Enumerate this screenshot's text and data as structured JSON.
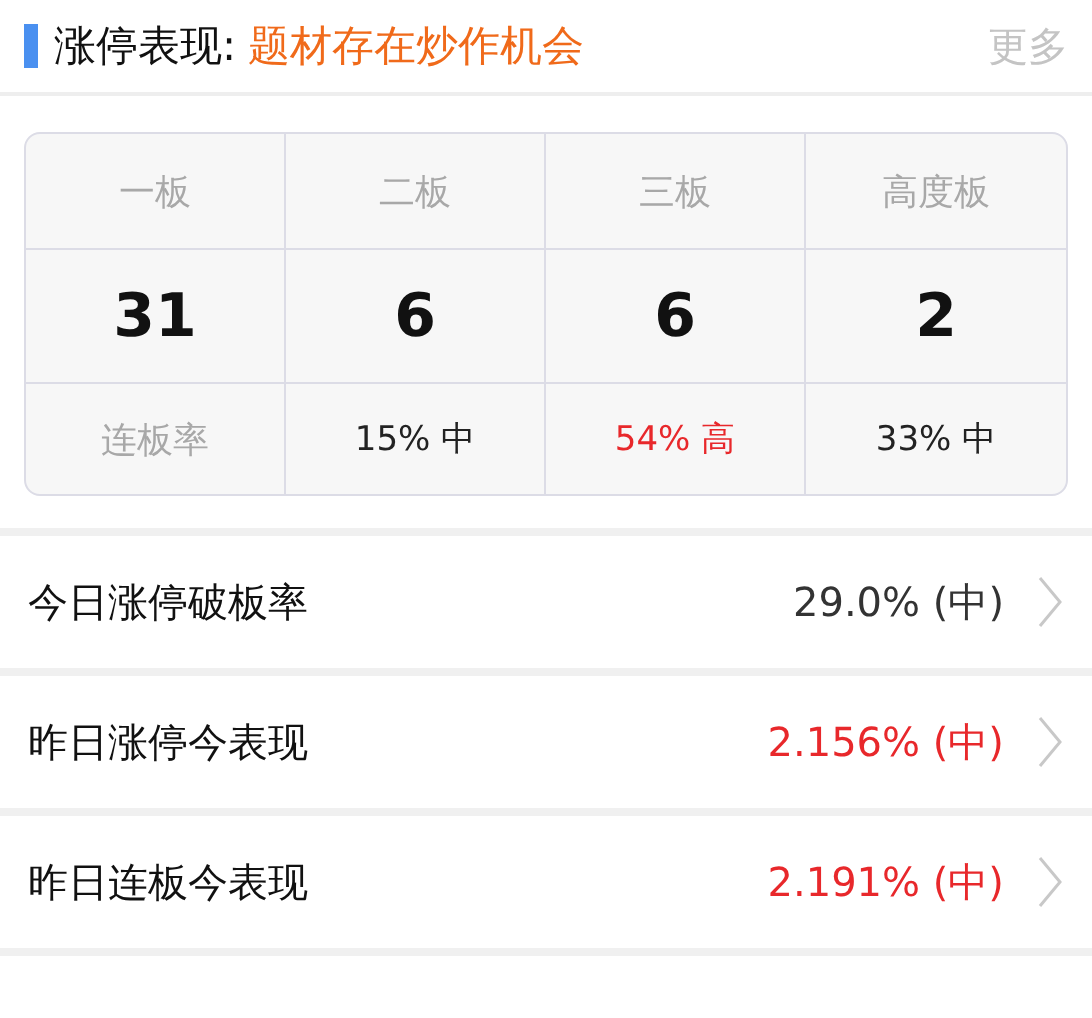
{
  "header": {
    "title": "涨停表现:",
    "highlight": "题材存在炒作机会",
    "more": "更多"
  },
  "board_table": {
    "columns": [
      "一板",
      "二板",
      "三板",
      "高度板"
    ],
    "counts": [
      "31",
      "6",
      "6",
      "2"
    ],
    "rate_label": "连板率",
    "rates": [
      {
        "text": "15% 中",
        "color": "#222222"
      },
      {
        "text": "54% 高",
        "color": "#e8282b"
      },
      {
        "text": "33% 中",
        "color": "#222222"
      }
    ]
  },
  "rows": [
    {
      "label": "今日涨停破板率",
      "value": "29.0% (中)",
      "color": "#333333"
    },
    {
      "label": "昨日涨停今表现",
      "value": "2.156% (中)",
      "color": "#e8282b"
    },
    {
      "label": "昨日连板今表现",
      "value": "2.191% (中)",
      "color": "#e8282b"
    }
  ]
}
